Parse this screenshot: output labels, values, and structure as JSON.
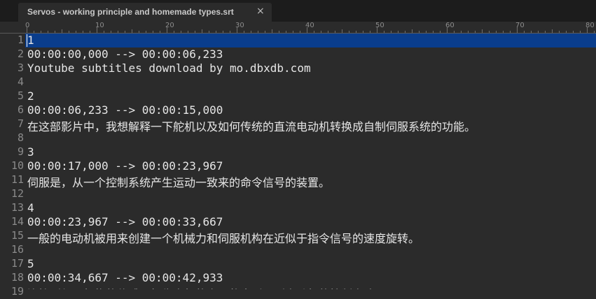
{
  "tab": {
    "title": "Servos - working principle and homemade types.srt",
    "close_glyph": "×"
  },
  "ruler": {
    "labels": [
      "0",
      "10",
      "20",
      "30",
      "40",
      "50",
      "60",
      "70",
      "80"
    ]
  },
  "editor": {
    "lines": [
      "1",
      "00:00:00,000 --> 00:00:06,233",
      "Youtube subtitles download by mo.dbxdb.com",
      "",
      "2",
      "00:00:06,233 --> 00:00:15,000",
      "在这部影片中，我想解释一下舵机以及如何传统的直流电动机转换成自制伺服系统的功能。",
      "",
      "3",
      "00:00:17,000 --> 00:00:23,967",
      "伺服是，从一个控制系统产生运动一致来的命令信号的装置。",
      "",
      "4",
      "00:00:23,967 --> 00:00:33,667",
      "一般的电动机被用来创建一个机械力和伺服机构在近似于指令信号的速度旋转。",
      "",
      "5",
      "00:00:34,667 --> 00:00:42,933",
      "连接到伺服机构的传感器报告电机的实际状态返回到电动机的控制电路。"
    ],
    "line_numbers": [
      "1",
      "2",
      "3",
      "4",
      "5",
      "6",
      "7",
      "8",
      "9",
      "10",
      "11",
      "12",
      "13",
      "14",
      "15",
      "16",
      "17",
      "18",
      "19"
    ],
    "current_line": 1
  },
  "colors": {
    "background": "#2b2b2b",
    "tabbar": "#1c1c1c",
    "text": "#e6e6e6",
    "line_number": "#8a8a8a",
    "current_line_highlight": "#0a3d8c"
  }
}
